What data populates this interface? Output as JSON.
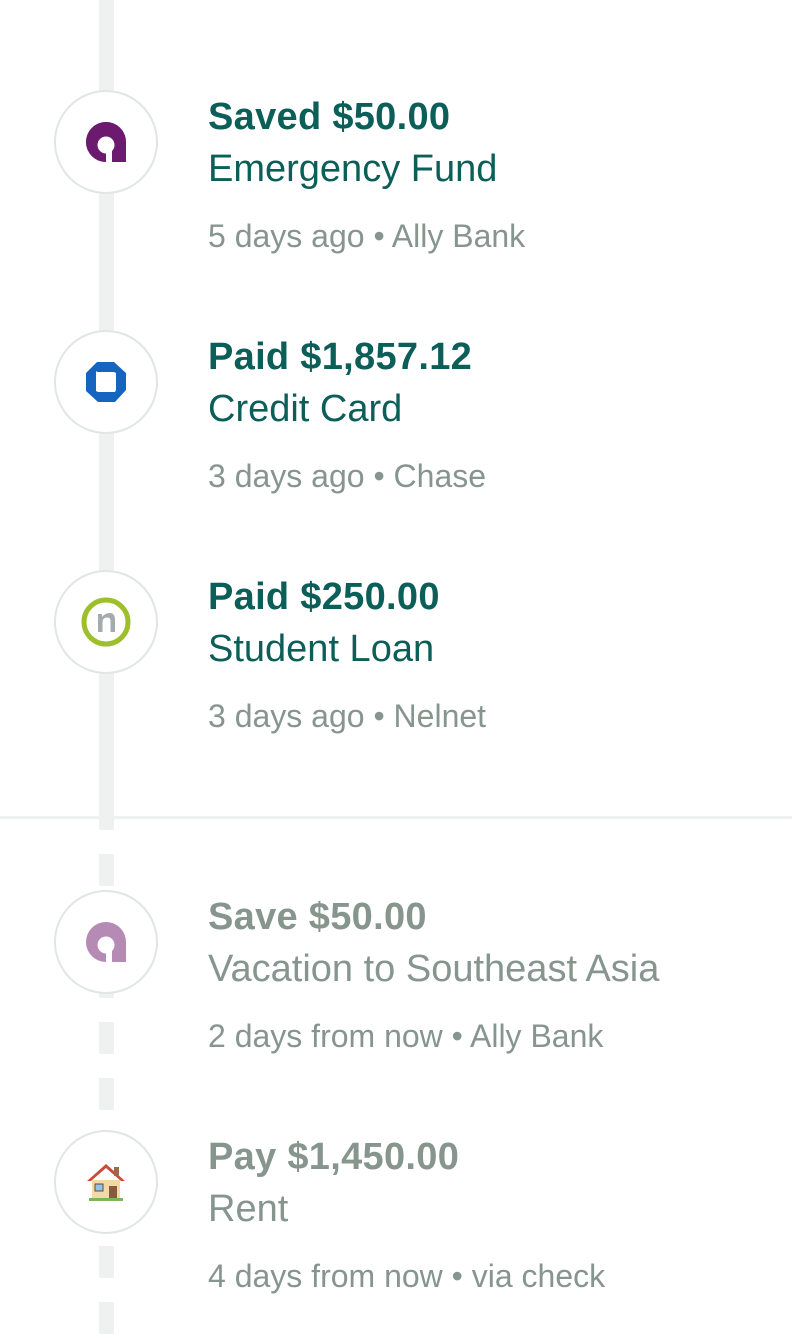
{
  "colors": {
    "past_text": "#0c5e58",
    "future_text": "#87958f",
    "ally_purple": "#6b1a6e",
    "ally_purple_faded": "#b58ab5",
    "chase_blue": "#1565c0",
    "nelnet_green": "#9cbf2b",
    "nelnet_gray": "#a5aaae",
    "timeline": "#eef1f0"
  },
  "completed": [
    {
      "icon": "ally-bank-logo-icon",
      "headline": "Saved $50.00",
      "category": "Emergency Fund",
      "when": "5 days ago",
      "separator": "•",
      "source": "Ally Bank"
    },
    {
      "icon": "chase-logo-icon",
      "headline": "Paid $1,857.12",
      "category": "Credit Card",
      "when": "3 days ago",
      "separator": "•",
      "source": "Chase"
    },
    {
      "icon": "nelnet-logo-icon",
      "headline": "Paid $250.00",
      "category": "Student Loan",
      "when": "3 days ago",
      "separator": "•",
      "source": "Nelnet"
    }
  ],
  "upcoming": [
    {
      "icon": "ally-bank-logo-icon",
      "headline": "Save $50.00",
      "category": "Vacation to Southeast Asia",
      "when": "2 days from now",
      "separator": "•",
      "source": "Ally Bank"
    },
    {
      "icon": "house-icon",
      "headline": "Pay $1,450.00",
      "category": "Rent",
      "when": "4 days from now",
      "separator": "•",
      "source": "via check"
    }
  ]
}
